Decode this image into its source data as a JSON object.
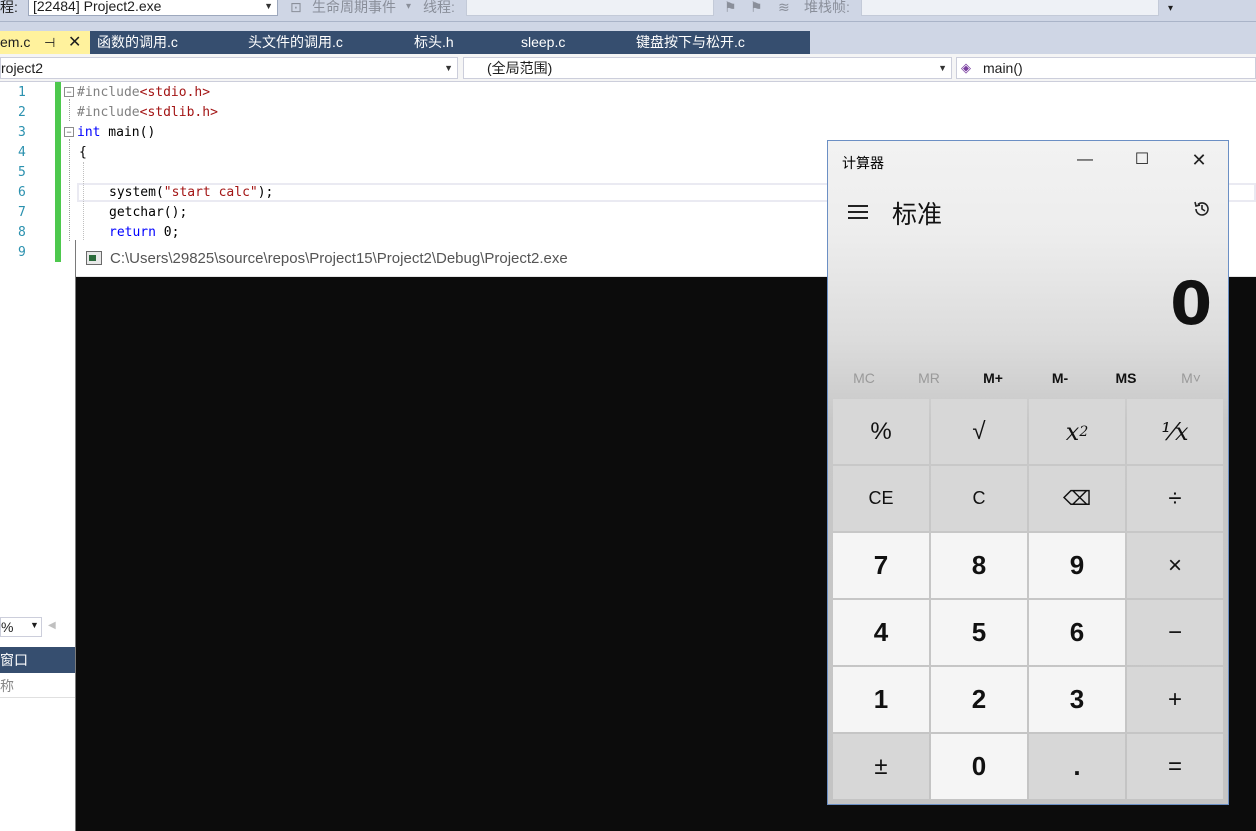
{
  "toolbar": {
    "process_label": "程:",
    "process_value": "[22484] Project2.exe",
    "lifecycle_label": "生命周期事件",
    "thread_label": "线程:",
    "stackframe_label": "堆栈帧:"
  },
  "tabs": [
    {
      "label": "em.c",
      "active": true
    },
    {
      "label": "函数的调用.c"
    },
    {
      "label": "头文件的调用.c"
    },
    {
      "label": "标头.h"
    },
    {
      "label": "sleep.c"
    },
    {
      "label": "键盘按下与松开.c"
    }
  ],
  "nav": {
    "project": "roject2",
    "scope": "(全局范围)",
    "member": "main()"
  },
  "editor": {
    "line_numbers": [
      "1",
      "2",
      "3",
      "4",
      "5",
      "6",
      "7",
      "8",
      "9"
    ],
    "lines": {
      "l1_pp": "#include",
      "l1_str": "<stdio.h>",
      "l2_pp": "#include",
      "l2_str": "<stdlib.h>",
      "l3_kw": "int",
      "l3_rest": " main()",
      "l4": "{",
      "l6_fn": "system(",
      "l6_str": "\"start calc\"",
      "l6_end": ");",
      "l7": "getchar();",
      "l8_kw": "return",
      "l8_rest": " 0;"
    }
  },
  "bottom_left": {
    "zoom": "%",
    "panel_title": "窗口",
    "column_header": "称"
  },
  "console": {
    "title": "C:\\Users\\29825\\source\\repos\\Project15\\Project2\\Debug\\Project2.exe"
  },
  "calculator": {
    "title": "计算器",
    "mode": "标准",
    "display": "0",
    "memory": [
      "MC",
      "MR",
      "M+",
      "M-",
      "MS",
      "M˅"
    ],
    "keys": {
      "percent": "%",
      "sqrt": "√",
      "square": "x",
      "square_exp": "2",
      "reciprocal": "⅟x",
      "ce": "CE",
      "c": "C",
      "backspace": "⌫",
      "divide": "÷",
      "seven": "7",
      "eight": "8",
      "nine": "9",
      "multiply": "×",
      "four": "4",
      "five": "5",
      "six": "6",
      "minus": "−",
      "one": "1",
      "two": "2",
      "three": "3",
      "plus": "+",
      "negate": "±",
      "zero": "0",
      "decimal": ".",
      "equals": "="
    }
  }
}
